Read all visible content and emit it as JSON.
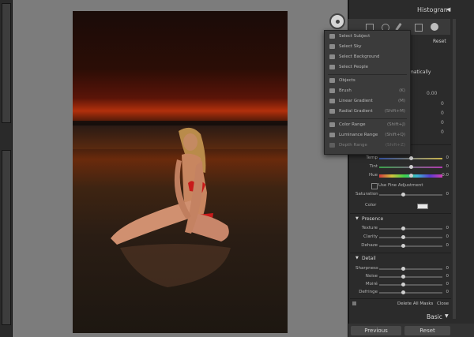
{
  "panel": {
    "title": "Histogram",
    "reset_label": "Reset",
    "auto_label": "matically",
    "arrow": "◀"
  },
  "menu": {
    "items": [
      {
        "label": "Select Subject",
        "key": ""
      },
      {
        "label": "Select Sky",
        "key": ""
      },
      {
        "label": "Select Background",
        "key": ""
      },
      {
        "label": "Select People",
        "key": ""
      },
      {
        "label": "Objects",
        "key": ""
      },
      {
        "label": "Brush",
        "key": "(K)"
      },
      {
        "label": "Linear Gradient",
        "key": "(M)"
      },
      {
        "label": "Radial Gradient",
        "key": "(Shift+M)"
      },
      {
        "label": "Color Range",
        "key": "(Shift+J)"
      },
      {
        "label": "Luminance Range",
        "key": "(Shift+Q)"
      },
      {
        "label": "Depth Range",
        "key": "(Shift+Z)"
      }
    ]
  },
  "top_values": [
    "0.00",
    "0",
    "0",
    "0",
    "0"
  ],
  "color_section": {
    "sliders": [
      {
        "label": "Temp",
        "value": "0"
      },
      {
        "label": "Tint",
        "value": "0"
      },
      {
        "label": "Hue",
        "value": "0.0"
      }
    ],
    "fine_adjust_label": "Use Fine Adjustment",
    "saturation": {
      "label": "Saturation",
      "value": "0"
    },
    "color_label": "Color"
  },
  "presence": {
    "title": "Presence",
    "sliders": [
      {
        "label": "Texture",
        "value": "0"
      },
      {
        "label": "Clarity",
        "value": "0"
      },
      {
        "label": "Dehaze",
        "value": "0"
      }
    ]
  },
  "detail": {
    "title": "Detail",
    "sliders": [
      {
        "label": "Sharpness",
        "value": "0"
      },
      {
        "label": "Noise",
        "value": "0"
      },
      {
        "label": "Moiré",
        "value": "0"
      },
      {
        "label": "Defringe",
        "value": "0"
      }
    ]
  },
  "footer": {
    "delete_all": "Delete All Masks",
    "close": "Close",
    "basic": "Basic",
    "previous": "Previous",
    "reset": "Reset"
  },
  "colors": {
    "accent": "#c8c8c8",
    "panel_bg": "#2b2b2b",
    "canvas_bg": "#7c7c7c"
  }
}
